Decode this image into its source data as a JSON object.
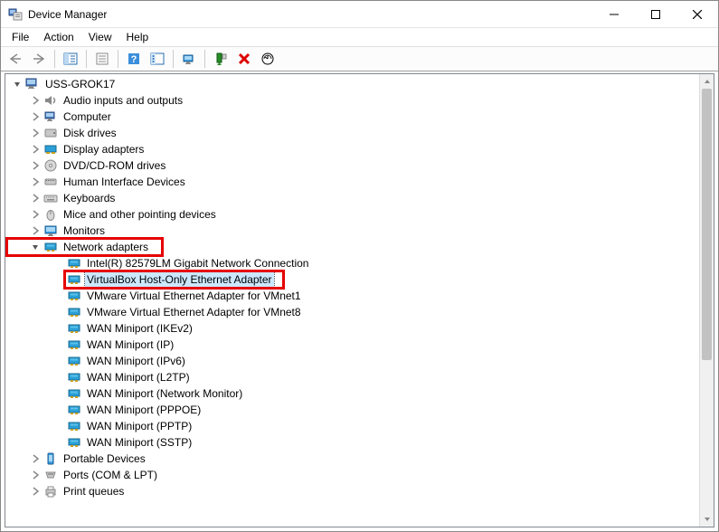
{
  "window": {
    "title": "Device Manager"
  },
  "menu": {
    "file": "File",
    "action": "Action",
    "view": "View",
    "help": "Help"
  },
  "tree": {
    "root": "USS-GROK17",
    "categories": {
      "audio": "Audio inputs and outputs",
      "computer": "Computer",
      "disk": "Disk drives",
      "display": "Display adapters",
      "dvd": "DVD/CD-ROM drives",
      "hid": "Human Interface Devices",
      "keyboards": "Keyboards",
      "mice": "Mice and other pointing devices",
      "monitors": "Monitors",
      "network": "Network adapters",
      "portable": "Portable Devices",
      "ports": "Ports (COM & LPT)",
      "print": "Print queues"
    },
    "network_children": [
      "Intel(R) 82579LM Gigabit Network Connection",
      "VirtualBox Host-Only Ethernet Adapter",
      "VMware Virtual Ethernet Adapter for VMnet1",
      "VMware Virtual Ethernet Adapter for VMnet8",
      "WAN Miniport (IKEv2)",
      "WAN Miniport (IP)",
      "WAN Miniport (IPv6)",
      "WAN Miniport (L2TP)",
      "WAN Miniport (Network Monitor)",
      "WAN Miniport (PPPOE)",
      "WAN Miniport (PPTP)",
      "WAN Miniport (SSTP)"
    ]
  }
}
